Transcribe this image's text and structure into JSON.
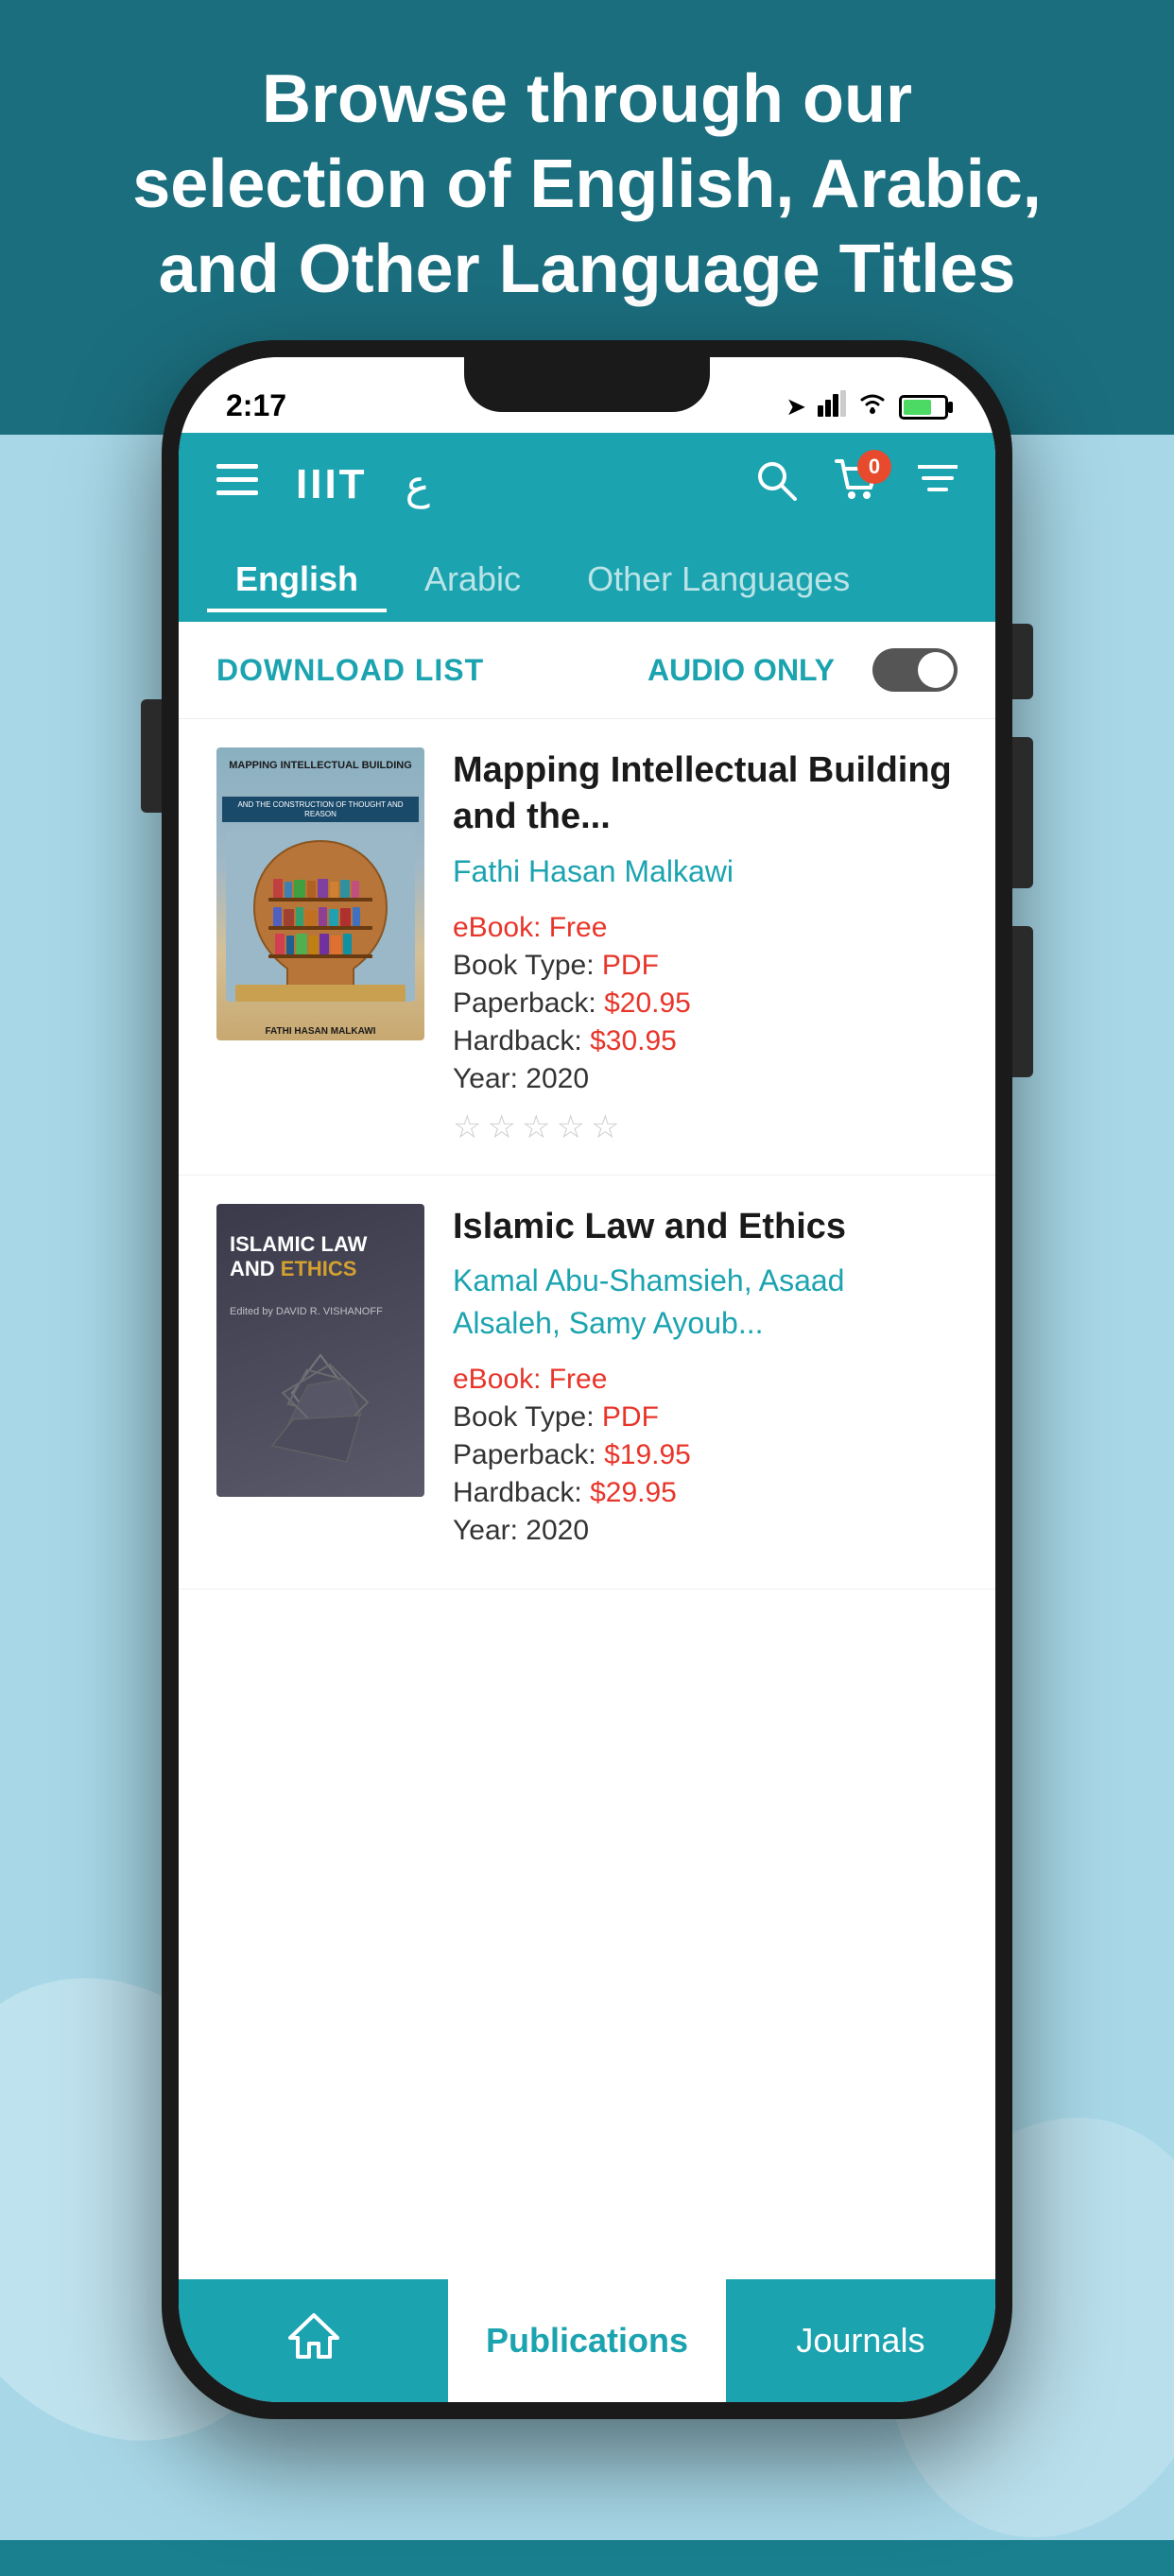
{
  "header": {
    "text_line1": "Browse through our",
    "text_line2": "selection of English, Arabic,",
    "text_line3": "and Other Language Titles"
  },
  "status_bar": {
    "time": "2:17",
    "cart_count": "0"
  },
  "nav": {
    "logo": "IIIT",
    "arabic_symbol": "ع"
  },
  "tabs": [
    {
      "label": "English",
      "active": true
    },
    {
      "label": "Arabic",
      "active": false
    },
    {
      "label": "Other Languages",
      "active": false
    }
  ],
  "filters": {
    "download_list": "DOWNLOAD LIST",
    "audio_only": "AUDIO ONLY"
  },
  "books": [
    {
      "title": "Mapping Intellectual Building and the...",
      "author": "Fathi Hasan Malkawi",
      "ebook": "eBook: Free",
      "book_type": "Book Type: ",
      "book_type_val": "PDF",
      "paperback": "Paperback: ",
      "paperback_val": "$20.95",
      "hardback": "Hardback: ",
      "hardback_val": "$30.95",
      "year": "Year:  2020",
      "cover_title": "MAPPING INTELLECTUAL BUILDING",
      "cover_subtitle": "AND THE CONSTRUCTION OF THOUGHT AND REASON",
      "cover_author": "FATHI HASAN MALKAWI"
    },
    {
      "title": "Islamic Law and Ethics",
      "author": "Kamal Abu-Shamsieh, Asaad Alsaleh, Samy Ayoub...",
      "ebook": "eBook: Free",
      "book_type": "Book Type: ",
      "book_type_val": "PDF",
      "paperback": "Paperback: ",
      "paperback_val": "$19.95",
      "hardback": "Hardback: ",
      "hardback_val": "$29.95",
      "year": "Year:  2020",
      "cover_title_1": "ISLAMIC LAW",
      "cover_title_2": "AND ETHICS",
      "cover_edited": "Edited by DAVID R. VISHANOFF"
    }
  ],
  "bottom_nav": {
    "home_icon": "🏠",
    "publications": "Publications",
    "journals": "Journals"
  }
}
